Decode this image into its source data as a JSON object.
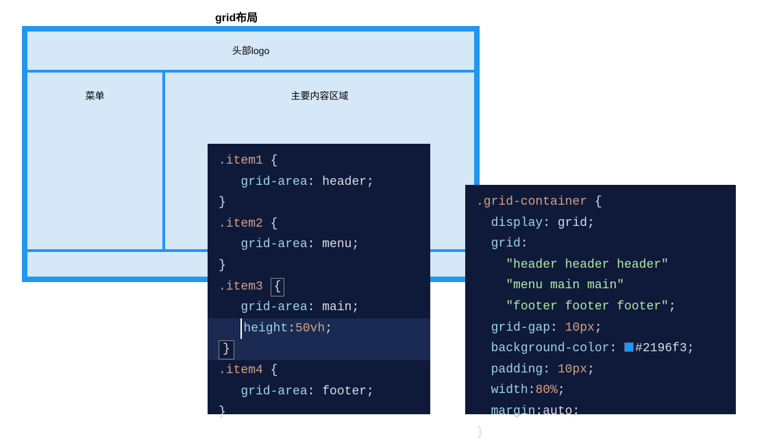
{
  "title": "grid布局",
  "grid_demo": {
    "header": "头部logo",
    "menu": "菜单",
    "main": "主要内容区域",
    "footer": ""
  },
  "code_left": {
    "lines": [
      {
        "cls": "",
        "segs": [
          {
            "t": ".item1 ",
            "c": "tk-sel"
          },
          {
            "t": "{",
            "c": "tk-brace"
          }
        ]
      },
      {
        "cls": "",
        "segs": [
          {
            "t": "   ",
            "c": "tk-val"
          },
          {
            "t": "grid-area",
            "c": "tk-prop"
          },
          {
            "t": ": ",
            "c": "tk-punct"
          },
          {
            "t": "header",
            "c": "tk-val"
          },
          {
            "t": ";",
            "c": "tk-punct"
          }
        ]
      },
      {
        "cls": "",
        "segs": [
          {
            "t": "}",
            "c": "tk-brace"
          }
        ]
      },
      {
        "cls": "",
        "segs": [
          {
            "t": ".item2 ",
            "c": "tk-sel"
          },
          {
            "t": "{",
            "c": "tk-brace"
          }
        ]
      },
      {
        "cls": "",
        "segs": [
          {
            "t": "   ",
            "c": "tk-val"
          },
          {
            "t": "grid-area",
            "c": "tk-prop"
          },
          {
            "t": ": ",
            "c": "tk-punct"
          },
          {
            "t": "menu",
            "c": "tk-val"
          },
          {
            "t": ";",
            "c": "tk-punct"
          }
        ]
      },
      {
        "cls": "",
        "segs": [
          {
            "t": "}",
            "c": "tk-brace"
          }
        ]
      },
      {
        "cls": "",
        "segs": [
          {
            "t": ".item3 ",
            "c": "tk-sel"
          },
          {
            "box": "{",
            "c": "tk-brace"
          }
        ]
      },
      {
        "cls": "",
        "segs": [
          {
            "t": "   ",
            "c": "tk-val"
          },
          {
            "t": "grid-area",
            "c": "tk-prop"
          },
          {
            "t": ": ",
            "c": "tk-punct"
          },
          {
            "t": "main",
            "c": "tk-val"
          },
          {
            "t": ";",
            "c": "tk-punct"
          }
        ]
      },
      {
        "cls": "hl-line",
        "segs": [
          {
            "t": "   ",
            "c": "tk-val"
          },
          {
            "caret": "height",
            "c": "tk-prop"
          },
          {
            "t": ":",
            "c": "tk-punct"
          },
          {
            "t": "50vh",
            "c": "tk-sel"
          },
          {
            "t": ";",
            "c": "tk-punct"
          }
        ]
      },
      {
        "cls": "close-hl",
        "segs": [
          {
            "closebox": "}",
            "c": "tk-brace"
          }
        ]
      },
      {
        "cls": "",
        "segs": [
          {
            "t": ".item4 ",
            "c": "tk-sel"
          },
          {
            "t": "{",
            "c": "tk-brace"
          }
        ]
      },
      {
        "cls": "",
        "segs": [
          {
            "t": "   ",
            "c": "tk-val"
          },
          {
            "t": "grid-area",
            "c": "tk-prop"
          },
          {
            "t": ": ",
            "c": "tk-punct"
          },
          {
            "t": "footer",
            "c": "tk-val"
          },
          {
            "t": ";",
            "c": "tk-punct"
          }
        ]
      },
      {
        "cls": "",
        "segs": [
          {
            "t": "}",
            "c": "tk-brace"
          }
        ]
      }
    ]
  },
  "code_right": {
    "lines": [
      {
        "cls": "",
        "segs": [
          {
            "t": ".grid-container ",
            "c": "tk-sel"
          },
          {
            "t": "{",
            "c": "tk-brace"
          }
        ]
      },
      {
        "cls": "",
        "segs": [
          {
            "t": "  ",
            "c": "tk-val"
          },
          {
            "t": "display",
            "c": "tk-prop"
          },
          {
            "t": ": ",
            "c": "tk-punct"
          },
          {
            "t": "grid",
            "c": "tk-val"
          },
          {
            "t": ";",
            "c": "tk-punct"
          }
        ]
      },
      {
        "cls": "",
        "segs": [
          {
            "t": "  ",
            "c": "tk-val"
          },
          {
            "t": "grid",
            "c": "tk-prop"
          },
          {
            "t": ":",
            "c": "tk-punct"
          }
        ]
      },
      {
        "cls": "",
        "segs": [
          {
            "t": "    ",
            "c": "tk-val"
          },
          {
            "t": "\"header header header\"",
            "c": "tk-str"
          }
        ]
      },
      {
        "cls": "",
        "segs": [
          {
            "t": "    ",
            "c": "tk-val"
          },
          {
            "t": "\"menu main main\"",
            "c": "tk-str"
          }
        ]
      },
      {
        "cls": "",
        "segs": [
          {
            "t": "    ",
            "c": "tk-val"
          },
          {
            "t": "\"footer footer footer\"",
            "c": "tk-str"
          },
          {
            "t": ";",
            "c": "tk-punct"
          }
        ]
      },
      {
        "cls": "",
        "segs": [
          {
            "t": "  ",
            "c": "tk-val"
          },
          {
            "t": "grid-gap",
            "c": "tk-prop"
          },
          {
            "t": ": ",
            "c": "tk-punct"
          },
          {
            "t": "10px",
            "c": "tk-sel"
          },
          {
            "t": ";",
            "c": "tk-punct"
          }
        ]
      },
      {
        "cls": "",
        "segs": [
          {
            "t": "  ",
            "c": "tk-val"
          },
          {
            "t": "background-color",
            "c": "tk-prop"
          },
          {
            "t": ": ",
            "c": "tk-punct"
          },
          {
            "swatch": true
          },
          {
            "t": "#2196f3",
            "c": "tk-val"
          },
          {
            "t": ";",
            "c": "tk-punct"
          }
        ]
      },
      {
        "cls": "",
        "segs": [
          {
            "t": "  ",
            "c": "tk-val"
          },
          {
            "t": "padding",
            "c": "tk-prop"
          },
          {
            "t": ": ",
            "c": "tk-punct"
          },
          {
            "t": "10px",
            "c": "tk-sel"
          },
          {
            "t": ";",
            "c": "tk-punct"
          }
        ]
      },
      {
        "cls": "",
        "segs": [
          {
            "t": "  ",
            "c": "tk-val"
          },
          {
            "t": "width",
            "c": "tk-prop"
          },
          {
            "t": ":",
            "c": "tk-punct"
          },
          {
            "t": "80%",
            "c": "tk-sel"
          },
          {
            "t": ";",
            "c": "tk-punct"
          }
        ]
      },
      {
        "cls": "",
        "segs": [
          {
            "t": "  ",
            "c": "tk-val"
          },
          {
            "t": "margin",
            "c": "tk-prop"
          },
          {
            "t": ":",
            "c": "tk-punct"
          },
          {
            "t": "auto",
            "c": "tk-val"
          },
          {
            "t": ";",
            "c": "tk-punct"
          }
        ]
      },
      {
        "cls": "",
        "segs": [
          {
            "t": "}",
            "c": "tk-brace"
          }
        ]
      }
    ]
  }
}
